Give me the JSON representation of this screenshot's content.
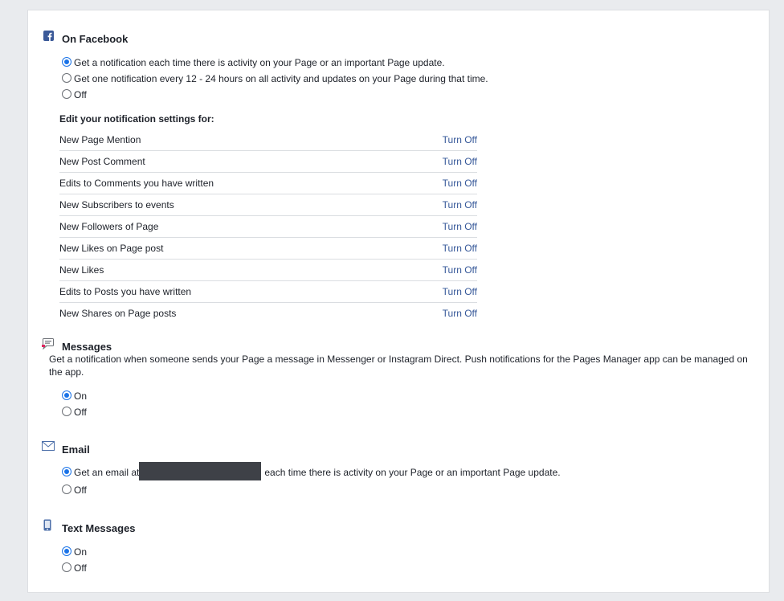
{
  "on_facebook": {
    "icon": "facebook-icon",
    "title": "On Facebook",
    "options": [
      {
        "label": "Get a notification each time there is activity on your Page or an important Page update.",
        "checked": true
      },
      {
        "label": "Get one notification every 12 - 24 hours on all activity and updates on your Page during that time.",
        "checked": false
      },
      {
        "label": "Off",
        "checked": false
      }
    ],
    "edit_heading": "Edit your notification settings for:",
    "settings": [
      {
        "label": "New Page Mention",
        "action": "Turn Off"
      },
      {
        "label": "New Post Comment",
        "action": "Turn Off"
      },
      {
        "label": "Edits to Comments you have written",
        "action": "Turn Off"
      },
      {
        "label": "New Subscribers to events",
        "action": "Turn Off"
      },
      {
        "label": "New Followers of Page",
        "action": "Turn Off"
      },
      {
        "label": "New Likes on Page post",
        "action": "Turn Off"
      },
      {
        "label": "New Likes",
        "action": "Turn Off"
      },
      {
        "label": "Edits to Posts you have written",
        "action": "Turn Off"
      },
      {
        "label": "New Shares on Page posts",
        "action": "Turn Off"
      }
    ]
  },
  "messages": {
    "icon": "chat-bubble-icon",
    "title": "Messages",
    "description": "Get a notification when someone sends your Page a message in Messenger or Instagram Direct. Push notifications for the Pages Manager app can be managed on the app.",
    "options": [
      {
        "label": "On",
        "checked": true
      },
      {
        "label": "Off",
        "checked": false
      }
    ]
  },
  "email": {
    "icon": "envelope-icon",
    "title": "Email",
    "option_prefix": "Get an email at",
    "option_suffix": "each time there is activity on your Page or an important Page update.",
    "options": [
      {
        "label": "Off",
        "checked": false
      }
    ]
  },
  "text_messages": {
    "icon": "mobile-phone-icon",
    "title": "Text Messages",
    "options": [
      {
        "label": "On",
        "checked": true
      },
      {
        "label": "Off",
        "checked": false
      }
    ]
  },
  "colors": {
    "link": "#365899",
    "radio_checked": "#1a73e8",
    "background": "#e9ebee"
  }
}
